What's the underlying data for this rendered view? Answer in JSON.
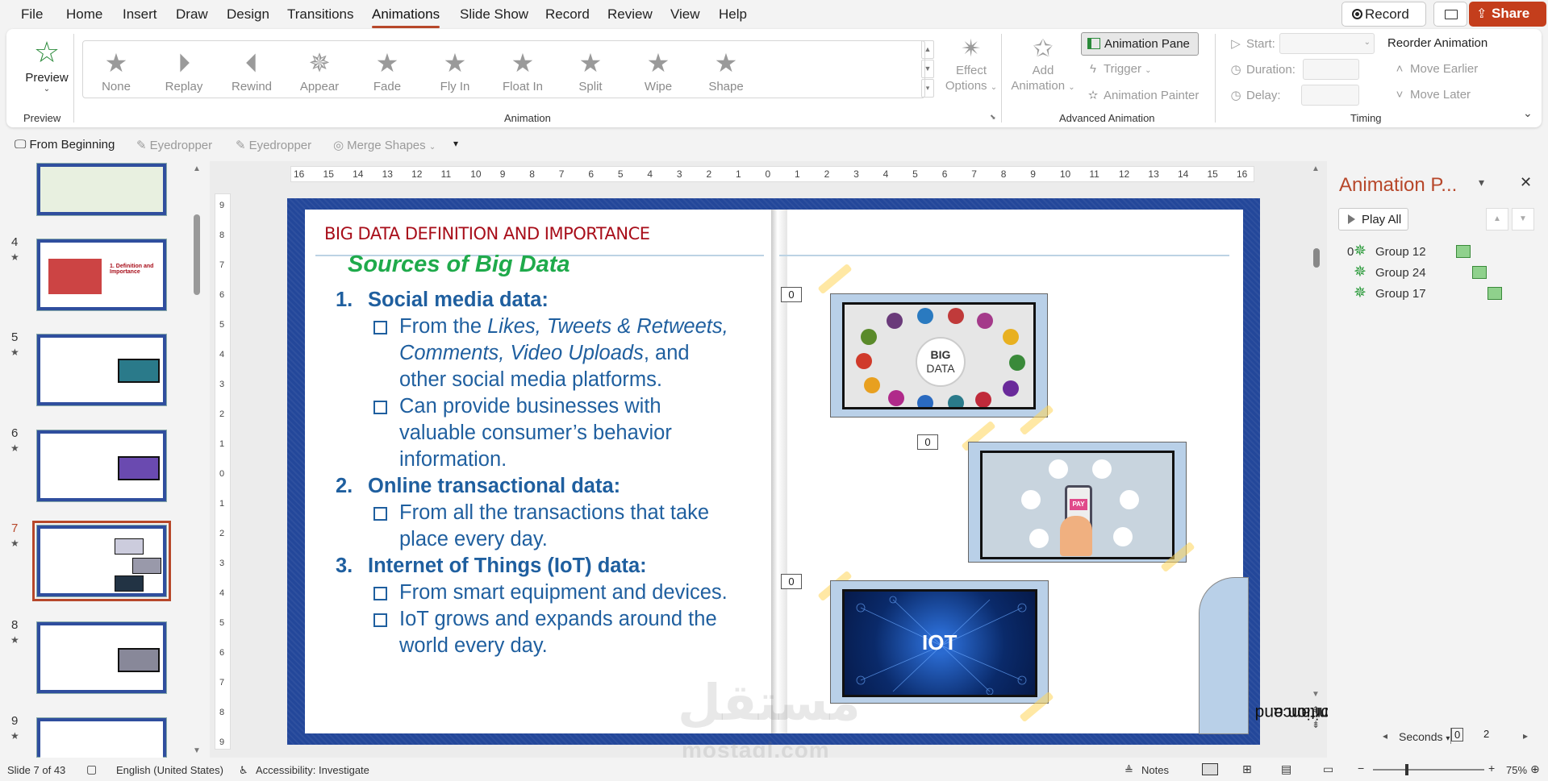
{
  "menu": {
    "items": [
      "File",
      "Home",
      "Insert",
      "Draw",
      "Design",
      "Transitions",
      "Animations",
      "Slide Show",
      "Record",
      "Review",
      "View",
      "Help"
    ],
    "active": "Animations",
    "record_label": "Record",
    "share_label": "Share"
  },
  "ribbon": {
    "preview": {
      "label": "Preview",
      "group": "Preview"
    },
    "animations": [
      "None",
      "Replay",
      "Rewind",
      "Appear",
      "Fade",
      "Fly In",
      "Float In",
      "Split",
      "Wipe",
      "Shape"
    ],
    "effect_options": [
      "Effect",
      "Options"
    ],
    "animation_group": "Animation",
    "add_animation": [
      "Add",
      "Animation"
    ],
    "animation_pane_btn": "Animation Pane",
    "trigger": "Trigger",
    "animation_painter": "Animation Painter",
    "advanced_group": "Advanced Animation",
    "start_label": "Start:",
    "duration_label": "Duration:",
    "delay_label": "Delay:",
    "reorder_label": "Reorder Animation",
    "move_earlier": "Move Earlier",
    "move_later": "Move Later",
    "timing_group": "Timing"
  },
  "qat": {
    "from_beginning": "From Beginning",
    "eyedropper1": "Eyedropper",
    "eyedropper2": "Eyedropper",
    "merge_shapes": "Merge Shapes"
  },
  "thumbnails": [
    {
      "num": "4",
      "title": "1. Definition and Importance"
    },
    {
      "num": "5",
      "title": ""
    },
    {
      "num": "6",
      "title": ""
    },
    {
      "num": "7",
      "title": "",
      "selected": true
    },
    {
      "num": "8",
      "title": ""
    },
    {
      "num": "9",
      "title": ""
    }
  ],
  "ruler": {
    "h": [
      "16",
      "15",
      "14",
      "13",
      "12",
      "11",
      "10",
      "9",
      "8",
      "7",
      "6",
      "5",
      "4",
      "3",
      "2",
      "1",
      "0",
      "1",
      "2",
      "3",
      "4",
      "5",
      "6",
      "7",
      "8",
      "9",
      "10",
      "11",
      "12",
      "13",
      "14",
      "15",
      "16"
    ],
    "v": [
      "9",
      "8",
      "7",
      "6",
      "5",
      "4",
      "3",
      "2",
      "1",
      "0",
      "1",
      "2",
      "3",
      "4",
      "5",
      "6",
      "7",
      "8",
      "9"
    ]
  },
  "slide": {
    "title": "BIG DATA DEFINITION AND IMPORTANCE",
    "subtitle": "Sources of Big Data",
    "sections": [
      {
        "num": "1.",
        "heading": "Social media data:",
        "bullets": [
          {
            "pre": "From the ",
            "em": "Likes, Tweets & Retweets, Comments, Video Uploads",
            "post": ", and other social media platforms."
          },
          {
            "pre": "Can provide businesses with valuable consumer’s behavior information.",
            "em": "",
            "post": ""
          }
        ]
      },
      {
        "num": "2.",
        "heading": "Online transactional data:",
        "bullets": [
          {
            "pre": "From all the transactions that take place every day.",
            "em": "",
            "post": ""
          }
        ]
      },
      {
        "num": "3.",
        "heading": "Internet of Things (IoT) data:",
        "bullets": [
          {
            "pre": "From smart equipment and devices.",
            "em": "",
            "post": ""
          },
          {
            "pre": "IoT grows and expands around the world every day.",
            "em": "",
            "post": ""
          }
        ]
      }
    ],
    "image1_text": [
      "BIG",
      "DATA"
    ],
    "image2_text": "PAY",
    "image3_text": "IOT",
    "anim_tags": [
      "0",
      "0",
      "0"
    ],
    "side_tab": [
      "Definition and",
      "Importance"
    ]
  },
  "animation_pane": {
    "title": "Animation P...",
    "play_all": "Play All",
    "items": [
      {
        "order": "0",
        "label": "Group 12"
      },
      {
        "order": "",
        "label": "Group 24"
      },
      {
        "order": "",
        "label": "Group 17"
      }
    ],
    "seconds_label": "Seconds",
    "timeline_start": "0",
    "timeline_mark": "2"
  },
  "status": {
    "slide_info": "Slide 7 of 43",
    "language": "English (United States)",
    "accessibility": "Accessibility: Investigate",
    "notes": "Notes",
    "zoom": "75%"
  },
  "watermark": {
    "arabic": "مستقل",
    "latin": "mostaql.com"
  },
  "colors": {
    "accent": "#b7472a",
    "share": "#c43e1c",
    "slide_title": "#a80e1a",
    "subtitle": "#1faa4b",
    "body": "#1f5f9f",
    "slide_bg": "#23479a"
  }
}
